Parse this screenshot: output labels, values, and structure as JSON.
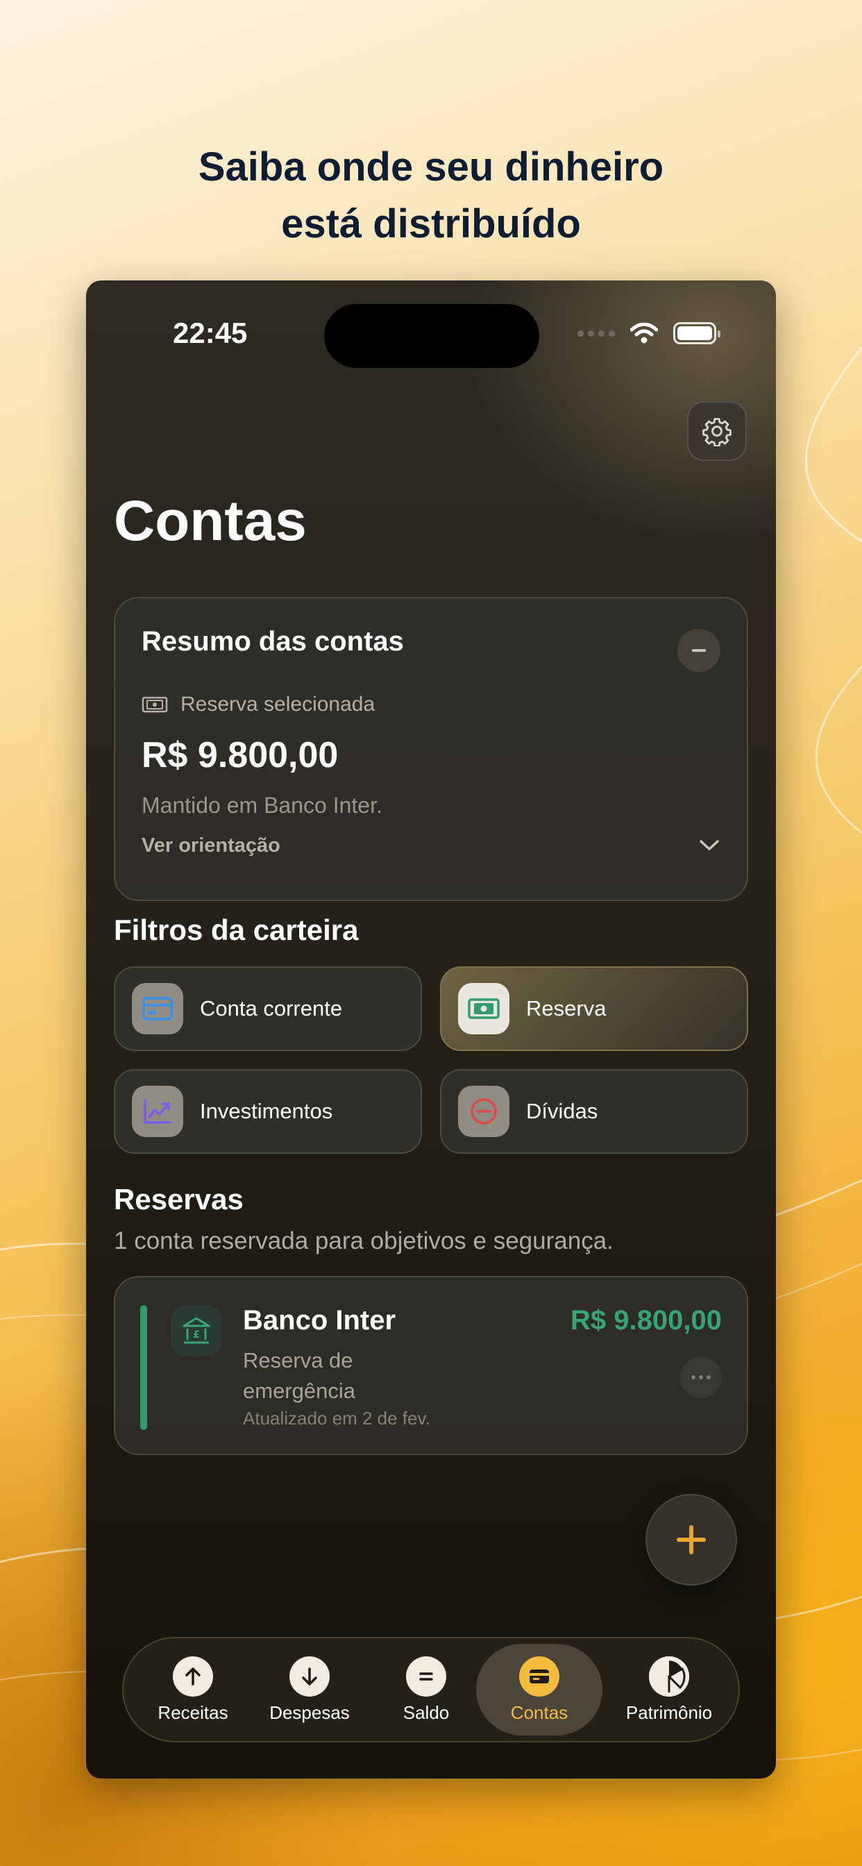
{
  "headline": {
    "line1": "Saiba onde seu dinheiro",
    "line2": "está distribuído"
  },
  "status_bar": {
    "time": "22:45"
  },
  "header": {
    "title": "Contas"
  },
  "summary": {
    "title": "Resumo das contas",
    "label": "Reserva selecionada",
    "amount": "R$ 9.800,00",
    "note": "Mantido em Banco Inter.",
    "guide": "Ver orientação"
  },
  "filters": {
    "title": "Filtros da carteira",
    "items": [
      {
        "label": "Conta corrente",
        "icon": "credit-card-icon",
        "active": false
      },
      {
        "label": "Reserva",
        "icon": "banknote-icon",
        "active": true
      },
      {
        "label": "Investimentos",
        "icon": "chart-up-icon",
        "active": false
      },
      {
        "label": "Dívidas",
        "icon": "minus-circle-icon",
        "active": false
      }
    ]
  },
  "reserves": {
    "title": "Reservas",
    "subtitle": "1 conta reservada para objetivos e segurança.",
    "accounts": [
      {
        "name": "Banco Inter",
        "type": "Reserva de emergência",
        "updated": "Atualizado em 2 de fev.",
        "amount": "R$ 9.800,00",
        "icon": "bank-icon"
      }
    ]
  },
  "tabbar": {
    "items": [
      {
        "label": "Receitas",
        "icon": "arrow-up-icon",
        "active": false
      },
      {
        "label": "Despesas",
        "icon": "arrow-down-icon",
        "active": false
      },
      {
        "label": "Saldo",
        "icon": "equals-icon",
        "active": false
      },
      {
        "label": "Contas",
        "icon": "wallet-icon",
        "active": true
      },
      {
        "label": "Patrimônio",
        "icon": "pie-chart-icon",
        "active": false
      }
    ]
  },
  "colors": {
    "accent": "#f4bc3c",
    "positive": "#37a476",
    "headline": "#0e1d33"
  }
}
